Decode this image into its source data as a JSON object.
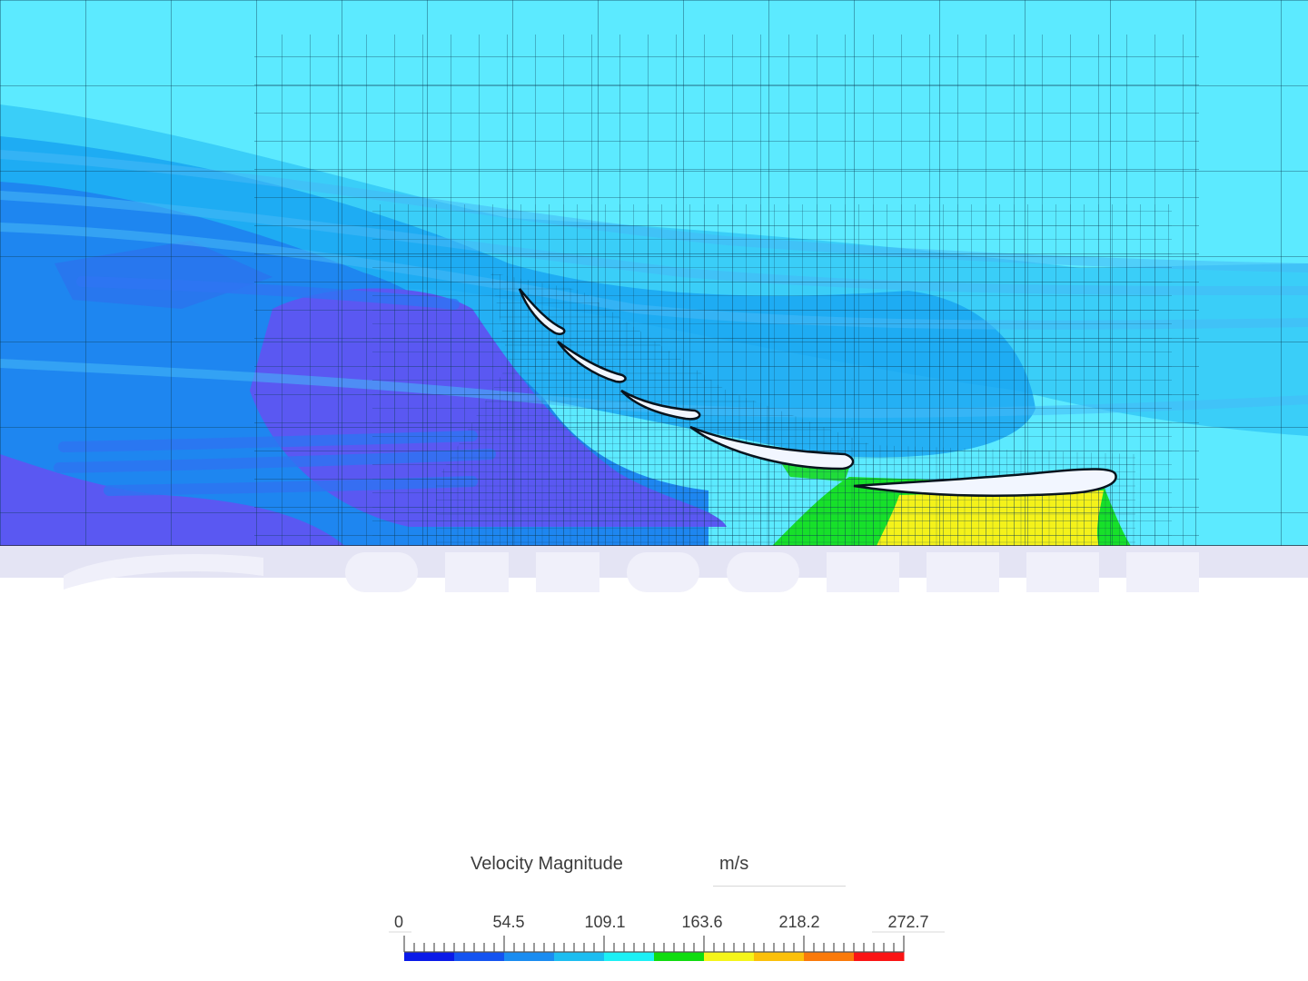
{
  "legend": {
    "title": "Velocity Magnitude",
    "unit": "m/s",
    "ticks": [
      "0",
      "54.5",
      "109.1",
      "163.6",
      "218.2",
      "272.7"
    ],
    "range": [
      0,
      272.7
    ],
    "colors": [
      "#0a1ae8",
      "#1453f0",
      "#1a8cf0",
      "#1cbdf0",
      "#1cf0f5",
      "#10dc10",
      "#f5f51a",
      "#fbc00a",
      "#fa7a0a",
      "#fa1414"
    ]
  },
  "scene": {
    "description_colors": {
      "freestream": "#5ceaff",
      "low_speed": "#6a5cf0",
      "ground": "#e4e4f4"
    }
  }
}
